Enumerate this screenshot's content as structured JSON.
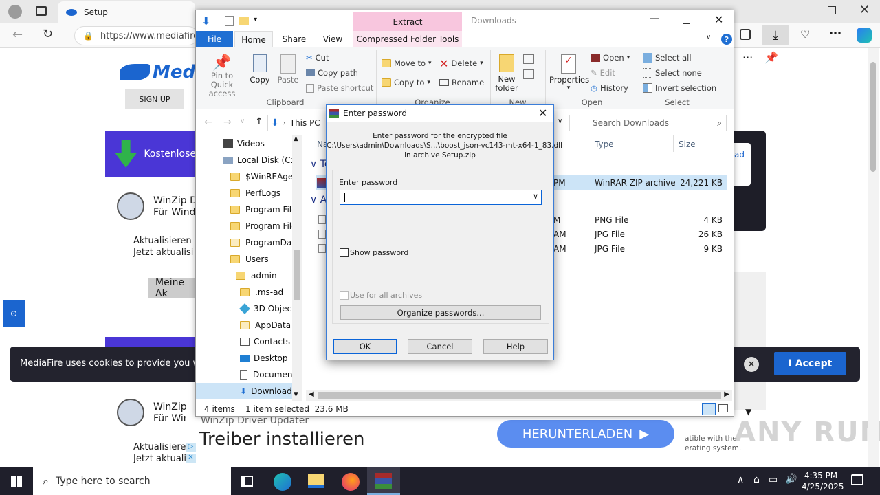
{
  "browser": {
    "tab_title": "Setup",
    "url": "https://www.mediafire",
    "more_label": "···"
  },
  "website": {
    "logo": "Medi",
    "signup": "SIGN UP",
    "banner_title": "Kostenlose",
    "ad1_title": "WinZip Dr",
    "ad1_sub": "Für Windo",
    "update_line1": "Aktualisieren S",
    "update_line2": "Jetzt aktualisi",
    "account_button": "Meine Ak",
    "ad2_title": "WinZip",
    "ad2_sub": "Für Win",
    "update2_line1": "Aktualisierer",
    "update2_line2": "Jetzt aktualis",
    "right_link": "ad",
    "bottom_ad_small": "WinZip Driver Updater",
    "bottom_ad_big": "Treiber installieren",
    "download_button": "HERUNTERLADEN",
    "side_text1": "atible with the",
    "side_text2": "erating system.",
    "cookie_text": "MediaFire uses cookies to provide you with a",
    "accept_button": "I Accept",
    "watermark": "ANY RUN"
  },
  "explorer": {
    "title": "Downloads",
    "contextual_tab": "Extract",
    "tabs": [
      "File",
      "Home",
      "Share",
      "View",
      "Compressed Folder Tools"
    ],
    "clipboard": {
      "pin": "Pin to Quick access",
      "copy": "Copy",
      "paste": "Paste",
      "cut": "Cut",
      "copy_path": "Copy path",
      "paste_shortcut": "Paste shortcut",
      "label": "Clipboard"
    },
    "organize": {
      "move_to": "Move to",
      "copy_to": "Copy to",
      "delete": "Delete",
      "rename": "Rename",
      "label": "Organize"
    },
    "new": {
      "new_folder": "New folder",
      "label": "New"
    },
    "open": {
      "properties": "Properties",
      "open": "Open",
      "edit": "Edit",
      "history": "History",
      "label": "Open"
    },
    "select": {
      "select_all": "Select all",
      "select_none": "Select none",
      "invert": "Invert selection",
      "label": "Select"
    },
    "address": "This PC",
    "search_placeholder": "Search Downloads",
    "tree": [
      "Videos",
      "Local Disk (C:)",
      "$WinREAgent",
      "PerfLogs",
      "Program Files",
      "Program Files",
      "ProgramData",
      "Users",
      "admin",
      ".ms-ad",
      "3D Objects",
      "AppData",
      "Contacts",
      "Desktop",
      "Documents",
      "Downloads"
    ],
    "columns": {
      "name": "Na",
      "type": "Type",
      "size": "Size"
    },
    "groups": {
      "today": "To",
      "earlier": "A"
    },
    "files": [
      {
        "time": "PM",
        "type": "WinRAR ZIP archive",
        "size": "24,221 KB"
      },
      {
        "time": "M",
        "type": "PNG File",
        "size": "4 KB"
      },
      {
        "time": "AM",
        "type": "JPG File",
        "size": "26 KB"
      },
      {
        "time": "AM",
        "type": "JPG File",
        "size": "9 KB"
      }
    ],
    "status_items": "4 items",
    "status_selected": "1 item selected  23.6 MB"
  },
  "dialog": {
    "title": "Enter password",
    "line1": "Enter password for the encrypted file",
    "line2": "C:\\Users\\admin\\Downloads\\S...\\boost_json-vc143-mt-x64-1_83.dll",
    "line3": "in archive Setup.zip",
    "field_label": "Enter password",
    "password_value": "",
    "show_password": "Show password",
    "use_all": "Use for all archives",
    "organize": "Organize passwords...",
    "ok": "OK",
    "cancel": "Cancel",
    "help": "Help"
  },
  "taskbar": {
    "search_placeholder": "Type here to search",
    "time": "4:35 PM",
    "date": "4/25/2025"
  },
  "colors": {
    "accent": "#0a64d8",
    "mediafire_blue": "#1b65cf",
    "purple": "#4a36d6",
    "extract_pink": "#f8c6de"
  }
}
